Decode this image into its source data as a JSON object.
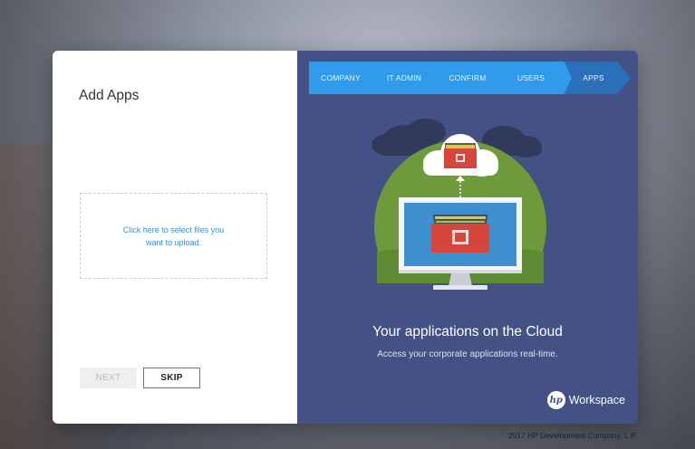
{
  "left": {
    "title": "Add Apps",
    "upload_prompt": "Click here to select files you want to upload.",
    "next_label": "NEXT",
    "skip_label": "SKIP"
  },
  "steps": [
    {
      "label": "COMPANY",
      "state": "completed"
    },
    {
      "label": "IT ADMIN",
      "state": "completed"
    },
    {
      "label": "CONFIRM",
      "state": "completed"
    },
    {
      "label": "USERS",
      "state": "completed"
    },
    {
      "label": "APPS",
      "state": "current"
    }
  ],
  "hero": {
    "headline": "Your applications on the Cloud",
    "subtext": "Access your corporate applications real-time."
  },
  "brand": {
    "logo_text": "hp",
    "name": "Workspace"
  },
  "footer": {
    "copyright": "2017 HP Development Company, L.P."
  },
  "colors": {
    "panel_bg": "#435185",
    "stepper_blue": "#2f9bea",
    "stepper_current": "#2a6fb8",
    "link_blue": "#3a8fd6"
  }
}
